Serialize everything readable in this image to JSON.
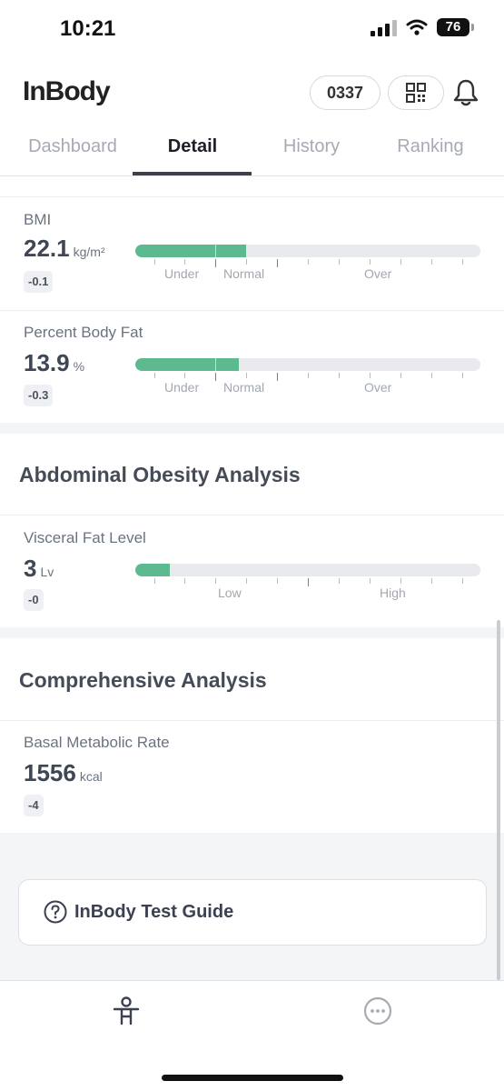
{
  "status": {
    "time": "10:21",
    "battery": "76"
  },
  "header": {
    "logo": "InBody",
    "code": "0337"
  },
  "tabs": [
    "Dashboard",
    "Detail",
    "History",
    "Ranking"
  ],
  "metrics": {
    "bmi": {
      "label": "BMI",
      "value": "22.1",
      "unit": "kg/m²",
      "change": "-0.1",
      "range_labels": [
        "Under",
        "Normal",
        "Over"
      ],
      "fill_fraction": 0.32
    },
    "pbf": {
      "label": "Percent Body Fat",
      "value": "13.9",
      "unit": "%",
      "change": "-0.3",
      "range_labels": [
        "Under",
        "Normal",
        "Over"
      ],
      "fill_fraction": 0.3
    },
    "visceral": {
      "label": "Visceral Fat Level",
      "value": "3",
      "unit": "Lv",
      "change": "-0",
      "range_labels": [
        "Low",
        "High"
      ],
      "fill_fraction": 0.1
    },
    "bmr": {
      "label": "Basal Metabolic Rate",
      "value": "1556",
      "unit": "kcal",
      "change": "-4"
    }
  },
  "sections": {
    "abdominal": "Abdominal Obesity Analysis",
    "comprehensive": "Comprehensive Analysis"
  },
  "guide": {
    "label": "InBody Test Guide"
  },
  "icons": {
    "qr": "qr-code-icon",
    "bell": "bell-icon",
    "help": "question-circle-icon",
    "body": "person-icon",
    "more": "more-dots-icon"
  },
  "colors": {
    "fill": "#5dba90",
    "track": "#e9eaee",
    "active_tab": "#1e2028"
  }
}
